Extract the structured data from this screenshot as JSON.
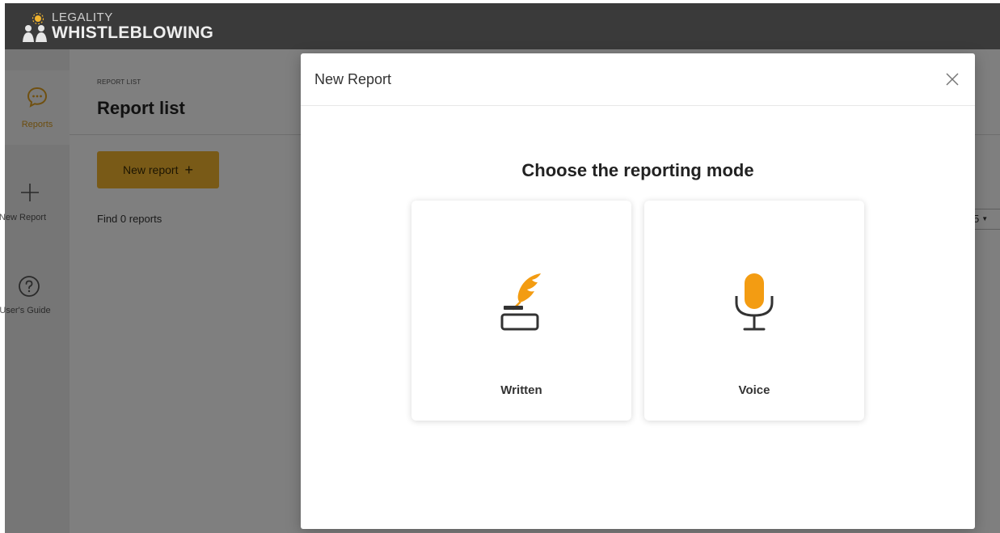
{
  "app": {
    "brand_line1": "LEGALITY",
    "brand_line2": "WHISTLEBLOWING"
  },
  "sidebar": {
    "items": [
      {
        "label": "Reports",
        "icon": "chat-bubble-icon",
        "active": true
      },
      {
        "label": "New Report",
        "icon": "plus-icon",
        "active": false
      },
      {
        "label": "User's Guide",
        "icon": "question-circle-icon",
        "active": false
      }
    ]
  },
  "page": {
    "breadcrumb": "REPORT LIST",
    "title": "Report list",
    "new_report_label": "New report",
    "found_text": "Find 0 reports",
    "per_page_value": "5"
  },
  "modal": {
    "title": "New Report",
    "heading": "Choose the reporting mode",
    "options": [
      {
        "label": "Written",
        "icon": "quill-inkpot-icon"
      },
      {
        "label": "Voice",
        "icon": "microphone-icon"
      }
    ]
  },
  "colors": {
    "accent": "#f3b52e",
    "icon_orange": "#f39c12",
    "topbar": "#3a3a3a"
  }
}
